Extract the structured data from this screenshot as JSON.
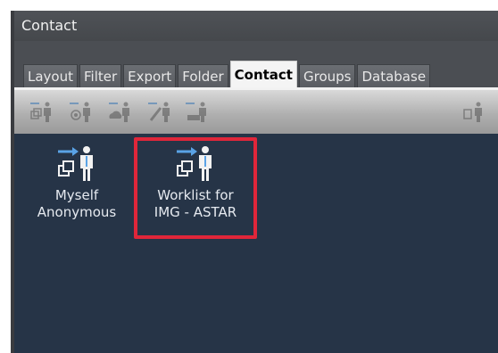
{
  "window": {
    "title": "Contact"
  },
  "tabs": [
    {
      "label": "Layout",
      "active": false
    },
    {
      "label": "Filter",
      "active": false
    },
    {
      "label": "Export",
      "active": false
    },
    {
      "label": "Folder",
      "active": false
    },
    {
      "label": "Contact",
      "active": true
    },
    {
      "label": "Groups",
      "active": false
    },
    {
      "label": "Database",
      "active": false
    }
  ],
  "toolbar": {
    "buttons": [
      {
        "icon": "add-contact-icon"
      },
      {
        "icon": "email-contact-icon"
      },
      {
        "icon": "cloud-contact-icon"
      },
      {
        "icon": "edit-contact-icon"
      },
      {
        "icon": "move-contact-icon"
      },
      {
        "icon": "contact-settings-icon"
      }
    ]
  },
  "contacts": [
    {
      "line1": "Myself",
      "line2": "Anonymous",
      "icon": "contact-person-icon",
      "highlighted": false
    },
    {
      "line1": "Worklist for",
      "line2": "IMG - ASTAR",
      "icon": "contact-person-icon",
      "highlighted": true
    }
  ],
  "colors": {
    "highlight": "#e0263a",
    "content_bg": "#263447",
    "icon_blue": "#5aa3e6"
  }
}
